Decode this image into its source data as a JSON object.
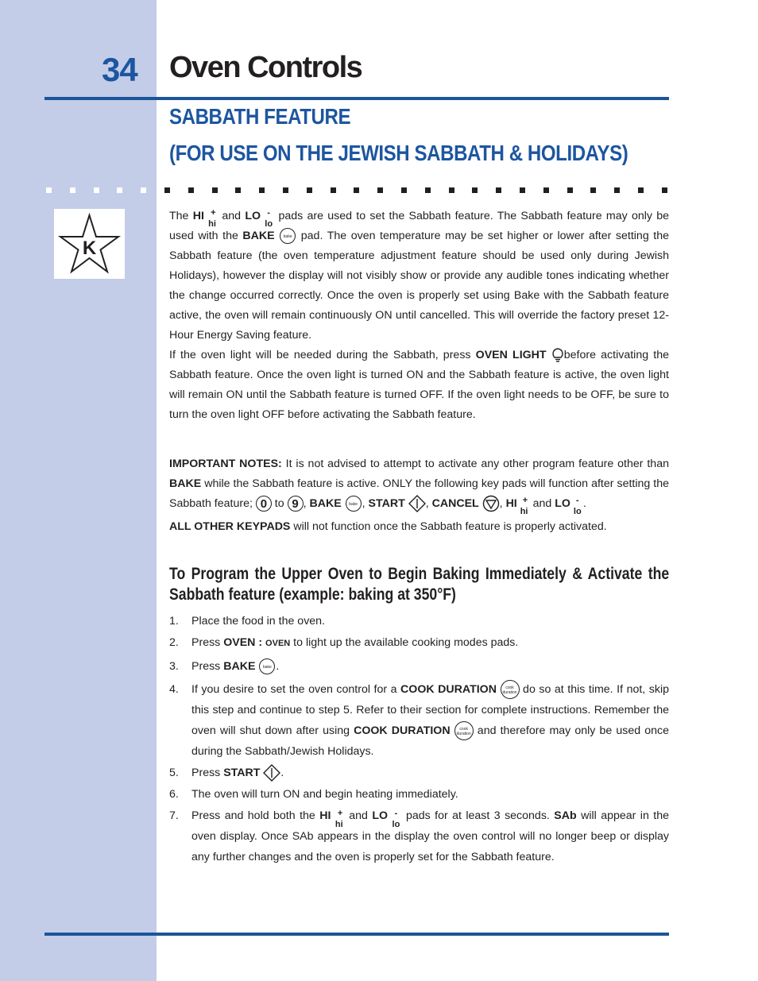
{
  "header": {
    "page_number": "34",
    "title": "Oven Controls"
  },
  "section": {
    "title_line1": "SABBATH FEATURE",
    "title_line2": "(FOR USE ON THE JEWISH SABBATH & HOLIDAYS)"
  },
  "logo": {
    "icon": "kosher-star-k-icon",
    "letter": "K"
  },
  "colors": {
    "accent": "#1d56a0",
    "sidebar": "#c3cde8",
    "rule": "#1b559a",
    "text": "#231f20"
  },
  "intro": {
    "p1_a": "The ",
    "hi": "HI",
    "hi_plus": "+",
    "hi_sub": "hi",
    "and": " and ",
    "lo": "LO",
    "lo_minus": "-",
    "lo_sub": "lo",
    "p1_b": " pads are used to set the Sabbath feature. The Sabbath feature may only be used with the ",
    "bake": "BAKE",
    "bake_pad": "bake",
    "p1_c": " pad. The oven temperature may be set higher or lower after setting the Sabbath feature (the oven temperature adjustment feature should be used only during Jewish Holidays), however the display will not visibly show or provide any audible tones indicating whether the change occurred correctly. Once the oven is properly set using Bake with the Sabbath feature active, the oven will remain continuously ON until cancelled. This will override the factory preset 12-Hour Energy Saving feature.",
    "p2_a": "If the oven light will be needed during the Sabbath, press ",
    "oven_light": "OVEN LIGHT",
    "p2_b": "before activating the Sabbath feature. Once the oven light is turned ON and the Sabbath feature is active, the oven light will remain ON until the Sabbath feature is turned OFF. If the oven light needs to be OFF, be sure to turn the oven light OFF before activating the Sabbath feature."
  },
  "notes": {
    "label": "IMPORTANT NOTES:",
    "text_a": " It is not advised to attempt to activate any other program feature other than ",
    "bake": "BAKE",
    "text_b": " while the Sabbath feature is active. ONLY the following key pads will function after setting the Sabbath feature; ",
    "zero": "0",
    "to": " to ",
    "nine": "9",
    "comma": ", ",
    "bake2": "BAKE",
    "start": "START",
    "cancel": "CANCEL",
    "hi": "HI",
    "and": " and ",
    "lo": "LO",
    "period": ".",
    "all_other": "ALL OTHER KEYPADS",
    "text_c": " will not function once the Sabbath feature is properly activated."
  },
  "procedure": {
    "heading": "To Program the Upper Oven to Begin Baking Immediately & Activate the Sabbath feature (example: baking at 350°F)",
    "steps": [
      {
        "n": "1.",
        "text": "Place the food in the oven."
      },
      {
        "n": "2.",
        "a": "Press ",
        "bold": "OVEN :",
        "small": "OVEN",
        "b": " to light up the available cooking modes pads."
      },
      {
        "n": "3.",
        "a": "Press ",
        "bold": "BAKE",
        "b": "."
      },
      {
        "n": "4.",
        "a": "If you desire to set the oven control for a ",
        "bold": "COOK DURATION",
        "pad_top": "cook",
        "pad_bottom": "duration",
        "b": " do so at this time. If not, skip this step and continue to step 5. Refer to their section for complete instructions. Remember the oven will shut down after using ",
        "bold2": "COOK DURATION",
        "c": " and therefore may only be used once during the Sabbath/Jewish Holidays."
      },
      {
        "n": "5.",
        "a": "Press ",
        "bold": "START",
        "b": "."
      },
      {
        "n": "6.",
        "text": "The oven will turn ON and begin heating immediately."
      },
      {
        "n": "7.",
        "a": "Press and hold both the ",
        "hi": "HI",
        "and": " and ",
        "lo": "LO",
        "b": " pads for at least 3 seconds. ",
        "sab": "SAb",
        "c": " will appear in the oven display. Once SAb appears in the display the oven control will no longer beep or display any further changes and the oven is properly set for the Sabbath feature."
      }
    ]
  }
}
